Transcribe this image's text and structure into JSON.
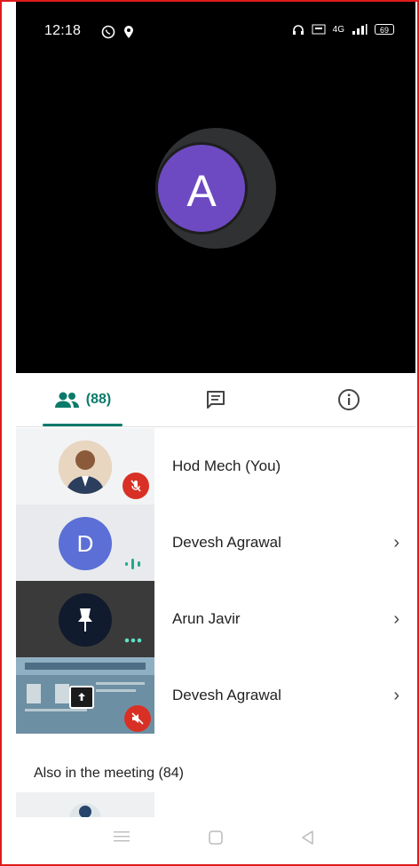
{
  "status_bar": {
    "time": "12:18",
    "network_label": "4G",
    "battery": "69"
  },
  "video": {
    "avatar_letter": "A",
    "name": "Arun Javir"
  },
  "tabs": {
    "people_count": "(88)"
  },
  "participants": [
    {
      "name": "Hod Mech (You)",
      "status": "muted"
    },
    {
      "name": "Devesh Agrawal",
      "avatar_letter": "D",
      "status": "speaking"
    },
    {
      "name": "Arun Javir",
      "status": "pinned"
    },
    {
      "name": "Devesh Agrawal",
      "status": "presenting-muted"
    }
  ],
  "also_in_meeting": {
    "title": "Also in the meeting (84)"
  },
  "colors": {
    "accent": "#0b7a6b",
    "avatar_purple": "#6e4ac2",
    "avatar_blue": "#5b6fd6",
    "mute_red": "#d93025",
    "frame_red": "#e01b1b"
  }
}
